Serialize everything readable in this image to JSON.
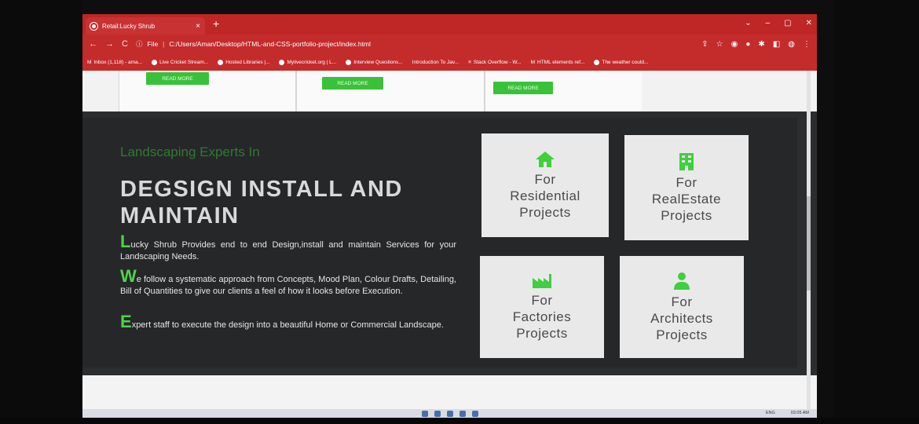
{
  "browser": {
    "tab_title": "Retail:Lucky Shrub",
    "tab_close": "×",
    "new_tab": "+",
    "window_controls": [
      "⌄",
      "–",
      "▢",
      "✕"
    ],
    "nav": {
      "back": "←",
      "forward": "→",
      "reload": "C"
    },
    "url_label": "File",
    "url_path": "C:/Users/Aman/Desktop/HTML-and-CSS-portfolio-project/index.html",
    "bookmarks": [
      "Inbox (1,118) - ama...",
      "Live Cricket Stream...",
      "Hosted Libraries |...",
      "Mylivecricket.org | L...",
      "Interview Questions...",
      "Introduction To Jav...",
      "Stack Overflow - W...",
      "HTML elements ref...",
      "The weather could..."
    ]
  },
  "top_cards": {
    "read_more": [
      "READ MORE",
      "READ MORE",
      "READ MORE"
    ]
  },
  "hero": {
    "eyebrow": "Landscaping Experts In",
    "headline": "DEGSIGN INSTALL AND MAINTAIN",
    "paragraphs": [
      {
        "cap": "L",
        "text": "ucky Shrub Provides end to end Design,install and maintain Services for your Landscaping Needs."
      },
      {
        "cap": "W",
        "text": "e follow a systematic approach from Concepts, Mood Plan, Colour Drafts, Detailing, Bill of Quantities to give our clients a feel of how it looks before Execution."
      },
      {
        "cap": "E",
        "text": "xpert staff to execute the design into a beautiful Home or Commercial Landscape."
      }
    ]
  },
  "services": [
    {
      "line1": "For",
      "line2": "Residential",
      "line3": "Projects",
      "icon": "home-icon"
    },
    {
      "line1": "For",
      "line2": "RealEstate",
      "line3": "Projects",
      "icon": "building-icon"
    },
    {
      "line1": "For",
      "line2": "Factories",
      "line3": "Projects",
      "icon": "factory-icon"
    },
    {
      "line1": "For",
      "line2": "Architects",
      "line3": "Projects",
      "icon": "person-icon"
    }
  ],
  "tray": {
    "lang": "ENG",
    "time": "03:05 AM"
  },
  "colors": {
    "accent_green": "#39c239",
    "browser_red": "#c42b2b",
    "dark_section": "#262729"
  }
}
